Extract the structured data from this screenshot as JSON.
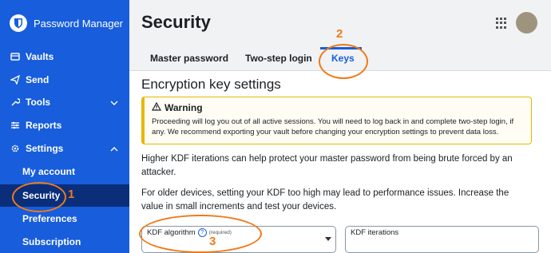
{
  "app": {
    "name": "Password Manager"
  },
  "sidebar": {
    "items": [
      {
        "label": "Vaults",
        "icon": "vault-icon"
      },
      {
        "label": "Send",
        "icon": "send-icon"
      },
      {
        "label": "Tools",
        "icon": "wrench-icon"
      },
      {
        "label": "Reports",
        "icon": "sliders-icon"
      },
      {
        "label": "Settings",
        "icon": "gear-icon"
      }
    ],
    "settings_children": [
      {
        "label": "My account"
      },
      {
        "label": "Security"
      },
      {
        "label": "Preferences"
      },
      {
        "label": "Subscription"
      }
    ]
  },
  "header": {
    "title": "Security"
  },
  "tabs": [
    {
      "label": "Master password"
    },
    {
      "label": "Two-step login"
    },
    {
      "label": "Keys"
    }
  ],
  "main": {
    "section_title": "Encryption key settings",
    "warning": {
      "title": "Warning",
      "body": "Proceeding will log you out of all active sessions. You will need to log back in and complete two-step login, if any. We recommend exporting your vault before changing your encryption settings to prevent data loss."
    },
    "paragraph1": "Higher KDF iterations can help protect your master password from being brute forced by an attacker.",
    "paragraph2": "For older devices, setting your KDF too high may lead to performance issues. Increase the value in small increments and test your devices.",
    "kdf_algorithm": {
      "label": "KDF algorithm",
      "required": "(required)"
    },
    "kdf_iterations": {
      "label": "KDF iterations"
    }
  },
  "annotations": [
    "1",
    "2",
    "3"
  ],
  "colors": {
    "brand": "#175ddc",
    "active_nav": "#0b2e7a",
    "annotation": "#f07a18",
    "warning": "#e6b800"
  }
}
